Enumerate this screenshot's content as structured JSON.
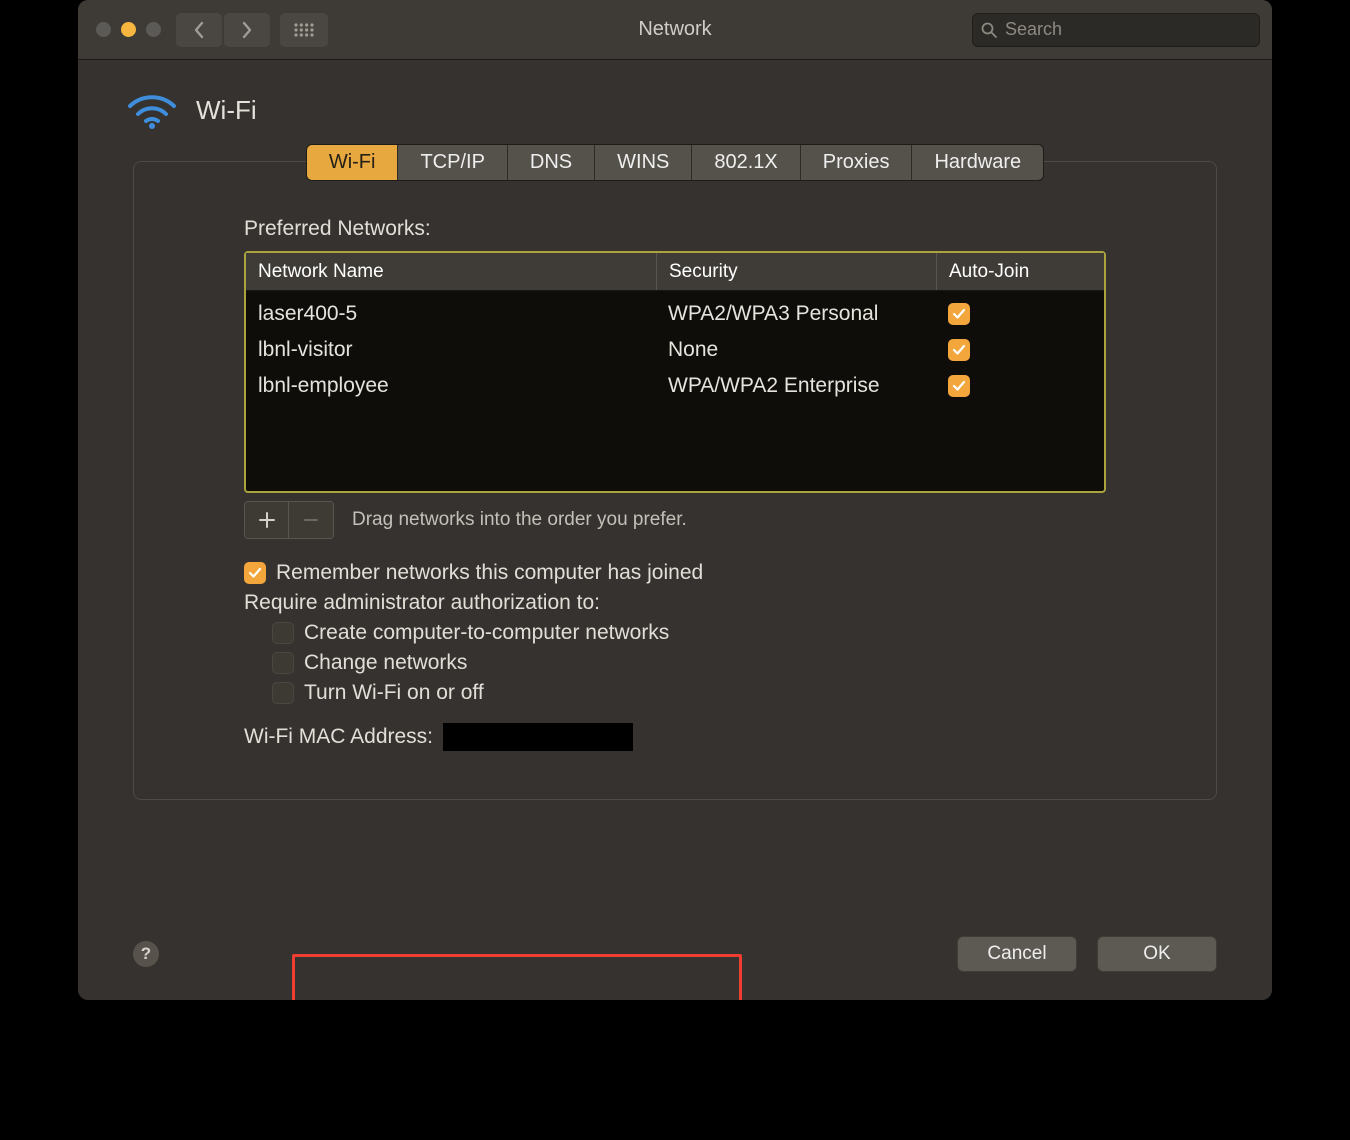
{
  "window": {
    "title": "Network"
  },
  "search": {
    "placeholder": "Search"
  },
  "header": {
    "title": "Wi-Fi"
  },
  "tabs": [
    {
      "label": "Wi-Fi",
      "active": true
    },
    {
      "label": "TCP/IP",
      "active": false
    },
    {
      "label": "DNS",
      "active": false
    },
    {
      "label": "WINS",
      "active": false
    },
    {
      "label": "802.1X",
      "active": false
    },
    {
      "label": "Proxies",
      "active": false
    },
    {
      "label": "Hardware",
      "active": false
    }
  ],
  "preferred": {
    "label": "Preferred Networks:",
    "columns": {
      "name": "Network Name",
      "security": "Security",
      "auto": "Auto-Join"
    },
    "rows": [
      {
        "name": "laser400-5",
        "security": "WPA2/WPA3 Personal",
        "auto": true
      },
      {
        "name": "lbnl-visitor",
        "security": "None",
        "auto": true
      },
      {
        "name": "lbnl-employee",
        "security": "WPA/WPA2 Enterprise",
        "auto": true
      }
    ],
    "hint": "Drag networks into the order you prefer."
  },
  "options": {
    "remember": {
      "label": "Remember networks this computer has joined",
      "checked": true
    },
    "require_label": "Require administrator authorization to:",
    "create": {
      "label": "Create computer-to-computer networks",
      "checked": false
    },
    "change": {
      "label": "Change networks",
      "checked": false
    },
    "power": {
      "label": "Turn Wi-Fi on or off",
      "checked": false
    }
  },
  "mac": {
    "label": "Wi-Fi MAC Address:",
    "value": ""
  },
  "footer": {
    "cancel": "Cancel",
    "ok": "OK"
  }
}
